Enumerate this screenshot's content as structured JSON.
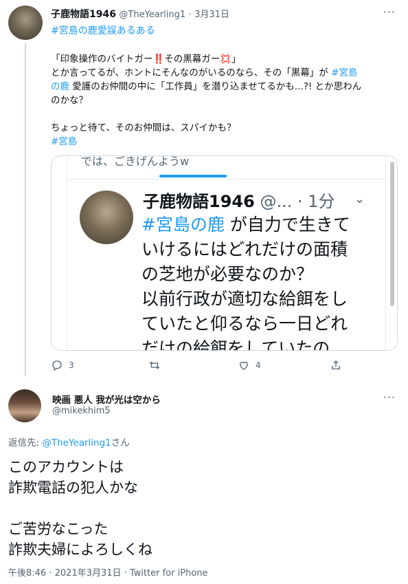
{
  "tweet1": {
    "name": "子鹿物語1946",
    "handle": "@TheYearling1",
    "separator": "·",
    "date": "3月31日",
    "more": "···",
    "hashtag_line": "#宮島の鹿愛誤あるある",
    "body": {
      "line1": "「印象操作のバイトガー",
      "line1_emoji1": "‼️",
      "line1_mid": "その黒幕ガー",
      "line1_emoji2": "💢",
      "line1_end": "」",
      "line2_start": "とか言ってるが、ホントにそんなのがいるのなら、その「黒幕」が",
      "line2_tag": "#宮島",
      "line3_tag": "の鹿",
      "line3_rest": "愛護のお仲間の中に「工作員」を潜り込ませてるかも...?! とか思わん",
      "line4": "のかな？",
      "line5": "ちょっと待て、そのお仲間は、スパイかも？",
      "line6_tag": "#宮島"
    },
    "embed": {
      "top_text": "では、ごきげんようw",
      "name": "子鹿物語1946",
      "handle": "@...",
      "time": "· 1分",
      "chevron": "⌄",
      "body_tag": "#宮島の鹿",
      "body_rest1": " が自力で生きて",
      "body_line2": "いけるにはどれだけの面積",
      "body_line3": "の芝地が必要なのか？",
      "body_line4": "以前行政が適切な給餌をし",
      "body_line5": "ていたと仰るなら一日どれ",
      "body_line6": "だけの給餌をしていたの"
    },
    "actions": {
      "reply_count": "3",
      "retweet_count": "",
      "like_count": "4"
    }
  },
  "tweet2": {
    "name": "映画 悪人 我が光は空から",
    "handle": "@mikekhim5",
    "more": "···",
    "reply_prefix": "返信先: ",
    "reply_handle": "@TheYearling1",
    "reply_suffix": "さん",
    "body": {
      "line1": "このアカウントは",
      "line2": "詐欺電話の犯人かな",
      "line3": "ご苦労なこった",
      "line4": "詐欺夫婦によろしくね"
    },
    "time": "午後8:46",
    "sep1": "·",
    "date": "2021年3月31日",
    "sep2": "·",
    "source": "Twitter for iPhone"
  },
  "colors": {
    "link": "#1d9bf0",
    "secondary": "#536471",
    "text": "#0f1419"
  }
}
